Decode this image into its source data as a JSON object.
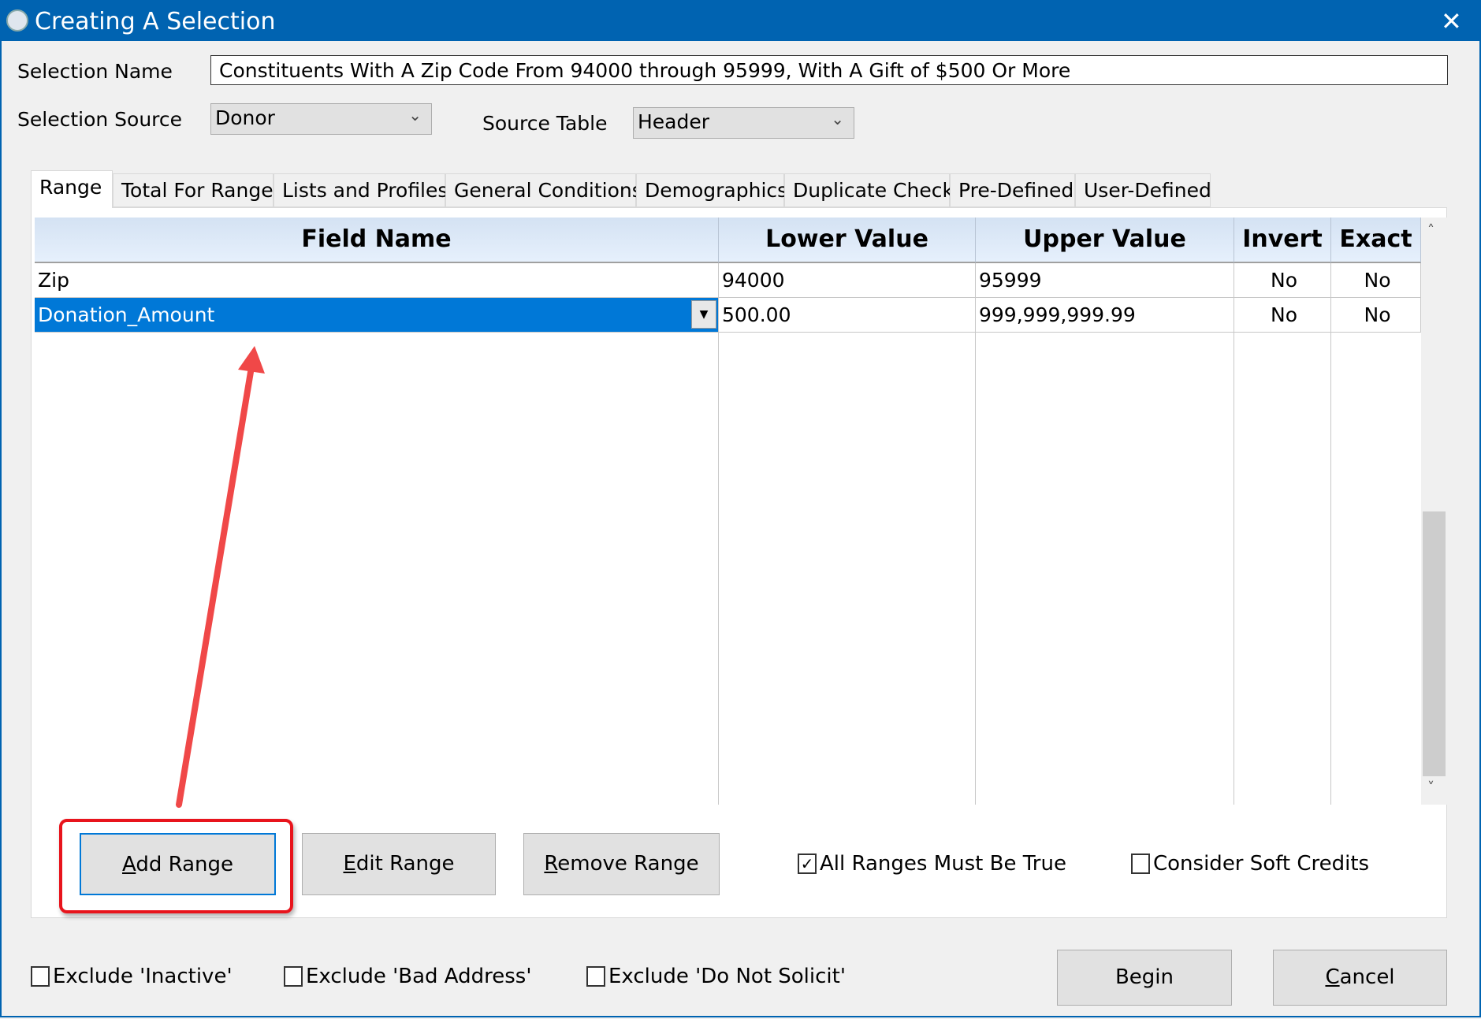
{
  "window": {
    "title": "Creating A Selection",
    "accent": "#0063b1"
  },
  "form": {
    "selection_name_label": "Selection Name",
    "selection_name_value": "Constituents With A Zip Code From 94000 through 95999, With A Gift of $500 Or More",
    "selection_source_label": "Selection Source",
    "selection_source_value": "Donor",
    "source_table_label": "Source Table",
    "source_table_value": "Header"
  },
  "tabs": [
    "Range",
    "Total For Range",
    "Lists and Profiles",
    "General Conditions",
    "Demographics",
    "Duplicate Check",
    "Pre-Defined",
    "User-Defined"
  ],
  "grid": {
    "columns": [
      "Field Name",
      "Lower Value",
      "Upper Value",
      "Invert",
      "Exact"
    ],
    "rows": [
      [
        "Zip",
        "94000",
        "95999",
        "No",
        "No"
      ],
      [
        "Donation_Amount",
        "500.00",
        "999,999,999.99",
        "No",
        "No"
      ]
    ],
    "selected_row": 1,
    "selection_color": "#0078d7"
  },
  "range_buttons": {
    "add_a": "A",
    "add_rest": "dd Range",
    "edit_a": "E",
    "edit_rest": "dit Range",
    "remove_a": "R",
    "remove_rest": "emove Range"
  },
  "options": {
    "all_ranges": {
      "label": "All Ranges Must Be True",
      "checked": true
    },
    "soft_credits": {
      "label": "Consider Soft Credits",
      "checked": false
    }
  },
  "excludes": [
    {
      "label": "Exclude 'Inactive'",
      "checked": false
    },
    {
      "label": "Exclude 'Bad Address'",
      "checked": false
    },
    {
      "label": "Exclude 'Do Not Solicit'",
      "checked": false
    }
  ],
  "footer": {
    "begin": "Begin",
    "cancel_c": "C",
    "cancel_rest": "ancel"
  },
  "annotation": {
    "highlight_color": "#e8141c",
    "arrow_color": "#f04848"
  }
}
